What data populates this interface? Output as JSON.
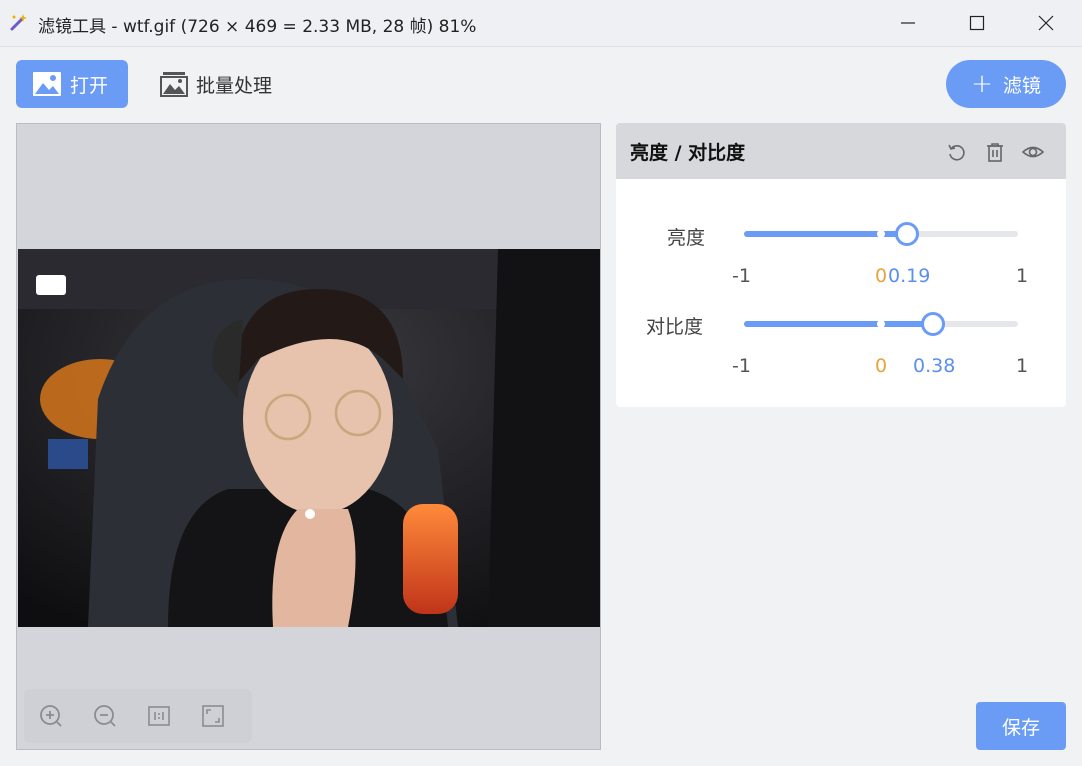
{
  "window": {
    "title": "滤镜工具 - wtf.gif (726 × 469 = 2.33 MB, 28 帧) 81%"
  },
  "toolbar": {
    "open_label": "打开",
    "batch_label": "批量处理",
    "add_filter_label": "滤镜"
  },
  "filter": {
    "title": "亮度 / 对比度",
    "sliders": [
      {
        "label": "亮度",
        "min_label": "-1",
        "zero_label": "0",
        "value_label": "0.19",
        "max_label": "1",
        "value": 0.19
      },
      {
        "label": "对比度",
        "min_label": "-1",
        "zero_label": "0",
        "value_label": "0.38",
        "max_label": "1",
        "value": 0.38
      }
    ]
  },
  "preview": {
    "zoom_tools": [
      "zoom-in-icon",
      "zoom-out-icon",
      "actual-size-icon",
      "fit-window-icon"
    ]
  },
  "save_label": "保存",
  "colors": {
    "accent": "#6b9cf5",
    "zero_marker": "#e8a33c"
  }
}
